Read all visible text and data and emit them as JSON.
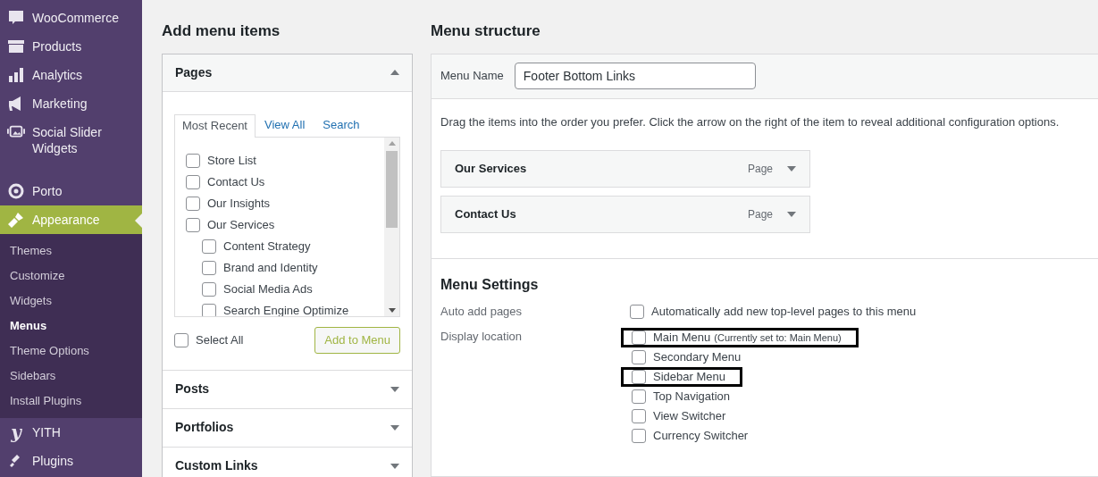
{
  "sidebar": {
    "items": [
      {
        "label": "WooCommerce",
        "kind": "woo",
        "selected": false
      },
      {
        "label": "Products",
        "kind": "box",
        "selected": false
      },
      {
        "label": "Analytics",
        "kind": "bars",
        "selected": false
      },
      {
        "label": "Marketing",
        "kind": "megaphone",
        "selected": false
      },
      {
        "label": "Social Slider Widgets",
        "kind": "slider",
        "selected": false
      },
      {
        "label": "Porto",
        "kind": "ring",
        "selected": false
      },
      {
        "label": "Appearance",
        "kind": "brush",
        "selected": true,
        "submenu": [
          {
            "label": "Themes",
            "selected": false
          },
          {
            "label": "Customize",
            "selected": false
          },
          {
            "label": "Widgets",
            "selected": false
          },
          {
            "label": "Menus",
            "selected": true
          },
          {
            "label": "Theme Options",
            "selected": false
          },
          {
            "label": "Sidebars",
            "selected": false
          },
          {
            "label": "Install Plugins",
            "selected": false
          }
        ]
      },
      {
        "label": "YITH",
        "kind": "y",
        "selected": false
      },
      {
        "label": "Plugins",
        "kind": "plug",
        "selected": false
      }
    ]
  },
  "add_items": {
    "title": "Add menu items",
    "sections": [
      {
        "title": "Pages",
        "expanded": true,
        "tabs": [
          {
            "label": "Most Recent",
            "selected": true
          },
          {
            "label": "View All",
            "selected": false
          },
          {
            "label": "Search",
            "selected": false
          }
        ],
        "pages": [
          {
            "label": "Store List",
            "checked": false
          },
          {
            "label": "Contact Us",
            "checked": false
          },
          {
            "label": "Our Insights",
            "checked": false
          },
          {
            "label": "Our Services",
            "checked": false,
            "children": [
              {
                "label": "Content Strategy",
                "checked": false
              },
              {
                "label": "Brand and Identity",
                "checked": false
              },
              {
                "label": "Social Media Ads",
                "checked": false
              },
              {
                "label": "Search Engine Optimize",
                "checked": false
              }
            ]
          }
        ],
        "select_all": {
          "label": "Select All",
          "checked": false
        },
        "button": "Add to Menu"
      },
      {
        "title": "Posts",
        "expanded": false
      },
      {
        "title": "Portfolios",
        "expanded": false
      },
      {
        "title": "Custom Links",
        "expanded": false
      }
    ]
  },
  "structure": {
    "title": "Menu structure",
    "menu_name": {
      "label": "Menu Name",
      "value": "Footer Bottom Links"
    },
    "instructions": "Drag the items into the order you prefer. Click the arrow on the right of the item to reveal additional configuration options.",
    "items": [
      {
        "title": "Our Services",
        "type": "Page"
      },
      {
        "title": "Contact Us",
        "type": "Page"
      }
    ],
    "settings": {
      "title": "Menu Settings",
      "auto_add": {
        "label": "Auto add pages",
        "option": "Automatically add new top-level pages to this menu",
        "checked": false
      },
      "display_location": {
        "label": "Display location",
        "locations": [
          {
            "label": "Main Menu",
            "note": "(Currently set to: Main Menu)",
            "checked": false,
            "highlighted": true
          },
          {
            "label": "Secondary Menu",
            "checked": false,
            "highlighted": false
          },
          {
            "label": "Sidebar Menu",
            "checked": false,
            "highlighted": true
          },
          {
            "label": "Top Navigation",
            "checked": false,
            "highlighted": false
          },
          {
            "label": "View Switcher",
            "checked": false,
            "highlighted": false
          },
          {
            "label": "Currency Switcher",
            "checked": false,
            "highlighted": false
          }
        ]
      }
    }
  }
}
